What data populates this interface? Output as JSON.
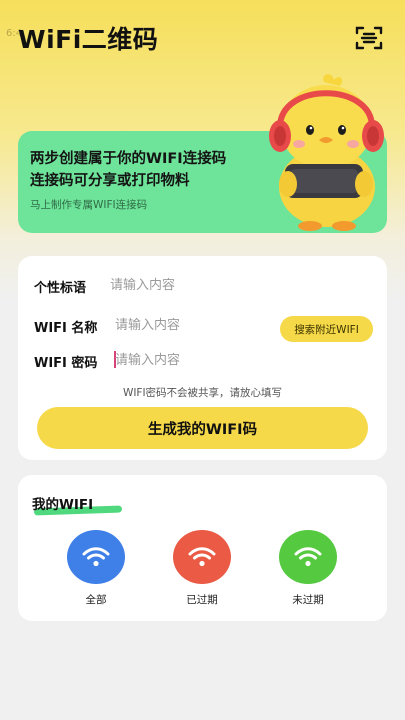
{
  "status": {
    "ghost_text": "6:4"
  },
  "header": {
    "title": "WiFi二维码",
    "scan_icon": "scan-icon"
  },
  "banner": {
    "line1": "两步创建属于你的WIFI连接码",
    "line2": "连接码可分享或打印物料",
    "subtitle": "马上制作专属WIFI连接码",
    "color": "#6ee39a"
  },
  "form": {
    "fields": [
      {
        "label": "个性标语",
        "placeholder": "请输入内容",
        "value": ""
      },
      {
        "label": "WIFI 名称",
        "placeholder": "请输入内容",
        "value": ""
      },
      {
        "label": "WIFI 密码",
        "placeholder": "请输入内容",
        "value": ""
      }
    ],
    "nearby_button": "搜索附近WIFI",
    "hint": "WIFI密码不会被共享，请放心填写",
    "generate_button": "生成我的WIFI码",
    "accent_color": "#f6d948"
  },
  "my_wifi": {
    "title": "我的WIFI",
    "items": [
      {
        "label": "全部",
        "icon": "wifi-icon",
        "color": "#3f7fe8"
      },
      {
        "label": "已过期",
        "icon": "wifi-icon",
        "color": "#ea5a45"
      },
      {
        "label": "未过期",
        "icon": "wifi-icon",
        "color": "#55c940"
      }
    ]
  }
}
